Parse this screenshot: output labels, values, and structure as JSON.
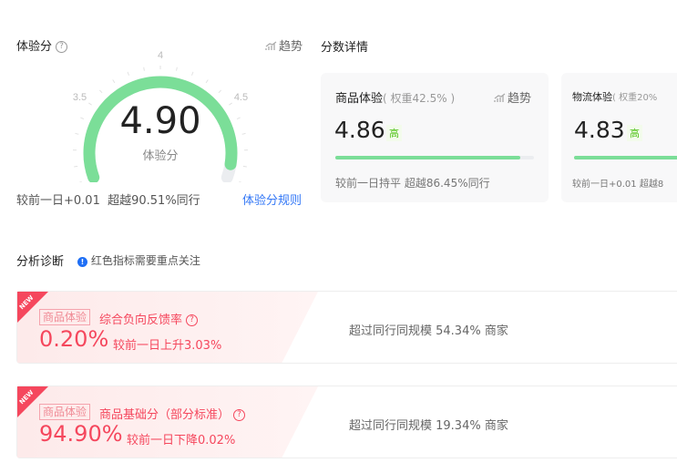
{
  "score": {
    "title": "体验分",
    "trend_label": "趋势",
    "value": "4.90",
    "value_label": "体验分",
    "gauge": {
      "min": 3,
      "max": 5,
      "current": 4.9,
      "ticks": [
        "3",
        "3.5",
        "4",
        "4.5",
        "5"
      ]
    },
    "compare": "较前一日+0.01",
    "exceed": "超越90.51%同行",
    "rules_link": "体验分规则"
  },
  "details": {
    "title": "分数详情",
    "cards": [
      {
        "name": "商品体验",
        "weight": "( 权重42.5% )",
        "trend_label": "趋势",
        "value": "4.86",
        "level": "高",
        "progress": 0.93,
        "compare": "较前一日持平",
        "exceed": "超越86.45%同行"
      },
      {
        "name": "物流体验",
        "weight": "( 权重20%",
        "value": "4.83",
        "level": "高",
        "progress": 0.93,
        "compare": "较前一日+0.01",
        "exceed": "超越8"
      }
    ]
  },
  "diagnosis": {
    "title": "分析诊断",
    "notice": "红色指标需要重点关注",
    "items": [
      {
        "badge": "NEW",
        "tag": "商品体验",
        "name": "综合负向反馈率",
        "value": "0.20%",
        "change": "较前一日上升3.03%",
        "peer": "超过同行同规模 54.34% 商家"
      },
      {
        "badge": "NEW",
        "tag": "商品体验",
        "name": "商品基础分（部分标准）",
        "value": "94.90%",
        "change": "较前一日下降0.02%",
        "peer": "超过同行同规模 19.34% 商家"
      }
    ]
  },
  "colors": {
    "green": "#7bde98",
    "red": "#f5475d",
    "link": "#3478f6"
  }
}
